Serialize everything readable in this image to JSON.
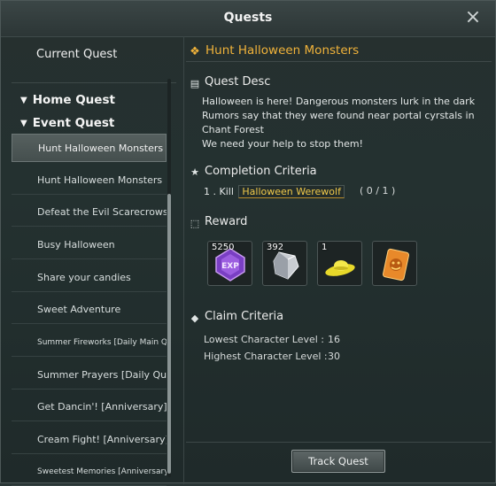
{
  "window": {
    "title": "Quests",
    "close_label": "×"
  },
  "sidebar": {
    "current_quest_label": "Current Quest",
    "categories": [
      {
        "label": "Home Quest"
      },
      {
        "label": "Event Quest"
      }
    ],
    "items": [
      {
        "label": "Hunt Halloween Monsters",
        "selected": true
      },
      {
        "label": "Hunt Halloween Monsters"
      },
      {
        "label": "Defeat the Evil Scarecrows"
      },
      {
        "label": "Busy Halloween"
      },
      {
        "label": "Share your candies"
      },
      {
        "label": "Sweet Adventure"
      },
      {
        "label": "Summer Fireworks [Daily Main Quest]"
      },
      {
        "label": "Summer Prayers [Daily Quest]"
      },
      {
        "label": "Get Dancin'! [Anniversary]"
      },
      {
        "label": "Cream Fight! [Anniversary]"
      },
      {
        "label": "Sweetest Memories [Anniversary]"
      }
    ]
  },
  "quest": {
    "title": "Hunt Halloween Monsters",
    "desc_heading": "Quest Desc",
    "desc_lines": [
      "Halloween is here! Dangerous monsters lurk in the dark",
      "Rumors say that they were found near portal cyrstals in Chant Forest",
      "We need your help to stop them!"
    ],
    "completion_heading": "Completion Criteria",
    "criteria": {
      "index": "1 .",
      "verb": "Kill",
      "target": "Halloween Werewolf",
      "progress": "( 0 / 1 )"
    },
    "reward_heading": "Reward",
    "rewards": [
      {
        "qty": "5250",
        "icon": "exp-crystal-icon"
      },
      {
        "qty": "392",
        "icon": "silver-crystal-icon"
      },
      {
        "qty": "1",
        "icon": "yellow-hat-icon"
      },
      {
        "qty": "",
        "icon": "pumpkin-ticket-icon"
      }
    ],
    "claim_heading": "Claim Criteria",
    "claim": [
      {
        "label": "Lowest Character Level :",
        "value": "16"
      },
      {
        "label": "Highest Character Level :",
        "value": "30"
      }
    ],
    "track_button": "Track Quest"
  },
  "colors": {
    "accent": "#f0b23a",
    "target": "#f0c94a"
  }
}
